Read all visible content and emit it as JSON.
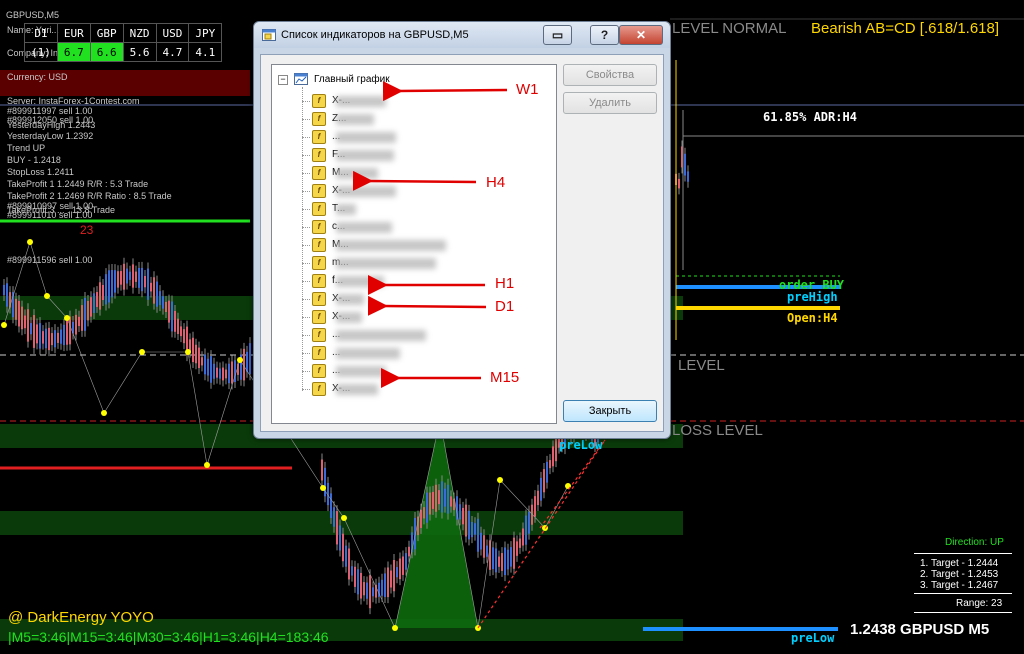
{
  "chart_window": {
    "symbol_title": "GBPUSD,M5",
    "pattern_label": "Bearish AB=CD [.618/1.618]",
    "adr_label": "61.85% ADR:H4",
    "order_buy_label": "order BUY",
    "pre_high_label": "preHigh",
    "open_h4_label": "Open:H4",
    "pre_low_label_mid": "preLow",
    "pre_low_label_bottom": "preLow",
    "price_symbol_label": "1.2438 GBPUSD M5",
    "level_normal_label": "LEVEL NORMAL",
    "level_mid_label": "LEVEL",
    "loss_level_label": "LOSS LEVEL",
    "count_label": "23",
    "colors": {
      "bull": "#3b6bd6",
      "bear": "#e06070",
      "zone_green": "#0a3a0a",
      "level_red": "#e02020",
      "level_green": "#20e020",
      "level_blue": "#1e90ff",
      "open_yellow": "#ffd700"
    }
  },
  "info_panel": {
    "lines": [
      "Name: Yuri...",
      "Company: Ins...",
      "Currency: USD",
      "Server: InstaForex-1Contest.com",
      "#899911997 sell 1.00",
      "#899912050 sell 1.00",
      "YesterdayHigh 1.2443",
      "YesterdayLow 1.2392",
      "Trend   UP",
      "BUY - 1.2418",
      "StopLoss 1.2411",
      "TakeProfit 1 1.2449 R/R : 5.3  Trade",
      "TakeProfit 2 1.2469 R/R Ratio : 8.5 Trade",
      "#899910997 sell 1.00",
      "#899911010 sell 1.00",
      "TakeProfit 3 ... : 13.8 Trade",
      "#899911596 sell 1.00"
    ]
  },
  "strength_table": {
    "headers": [
      "D1",
      "EUR",
      "GBP",
      "NZD",
      "USD",
      "JPY"
    ],
    "row": [
      "(1)",
      "6.7",
      "6.6",
      "5.6",
      "4.7",
      "4.1"
    ]
  },
  "watermark": {
    "author": "@ DarkEnergy YOYO",
    "timeframes": "|M5=3:46|M15=3:46|M30=3:46|H1=3:46|H4=183:46"
  },
  "stats_box": {
    "direction": "Direction: UP",
    "targets": [
      "1. Target - 1.2444",
      "2. Target - 1.2453",
      "3. Target - 1.2467"
    ],
    "range": "Range: 23"
  },
  "dialog": {
    "title": "Список индикаторов на GBPUSD,M5",
    "root_label": "Главный график",
    "items": [
      "X-...",
      "Z...",
      "...",
      "F...",
      "M...",
      "X-...",
      "T...",
      "c...",
      "M...",
      "m...",
      "f...",
      "X-...",
      "X-...",
      "...",
      "...",
      "...",
      "X-..."
    ],
    "properties_button": "Свойства",
    "delete_button": "Удалить",
    "close_button": "Закрыть",
    "title_buttons": [
      "▭",
      "?",
      "✕"
    ]
  },
  "annotations": [
    "W1",
    "H4",
    "H1",
    "D1",
    "M15"
  ]
}
